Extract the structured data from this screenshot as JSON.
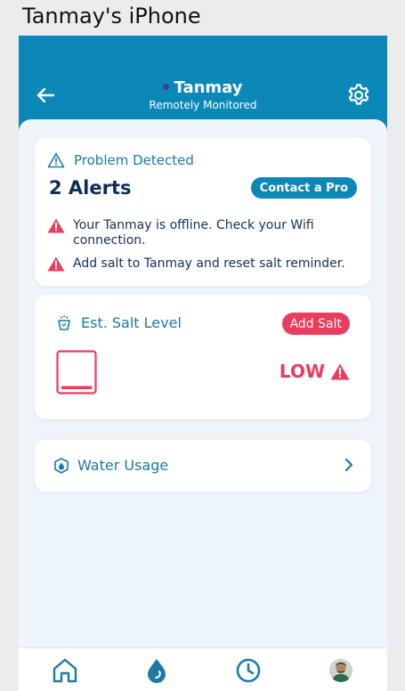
{
  "window": {
    "title": "Tanmay's iPhone"
  },
  "header": {
    "name": "Tanmay",
    "subtitle": "Remotely Monitored",
    "back_icon": "arrow-left-icon",
    "settings_icon": "gear-icon",
    "color": "#0b87b8"
  },
  "alerts_card": {
    "status_label": "Problem Detected",
    "count_label": "2 Alerts",
    "contact_button": "Contact a Pro",
    "items": [
      "Your Tanmay is offline. Check your Wifi connection.",
      "Add salt to Tanmay and reset salt reminder."
    ],
    "warning_color": "#ea3d5d"
  },
  "salt_card": {
    "title": "Est. Salt Level",
    "button": "Add Salt",
    "level_label": "LOW",
    "level_fraction": 0.08
  },
  "water_card": {
    "title": "Water Usage"
  },
  "bottom_nav": {
    "items": [
      "home-icon",
      "water-drop-icon",
      "clock-icon",
      "avatar"
    ]
  }
}
